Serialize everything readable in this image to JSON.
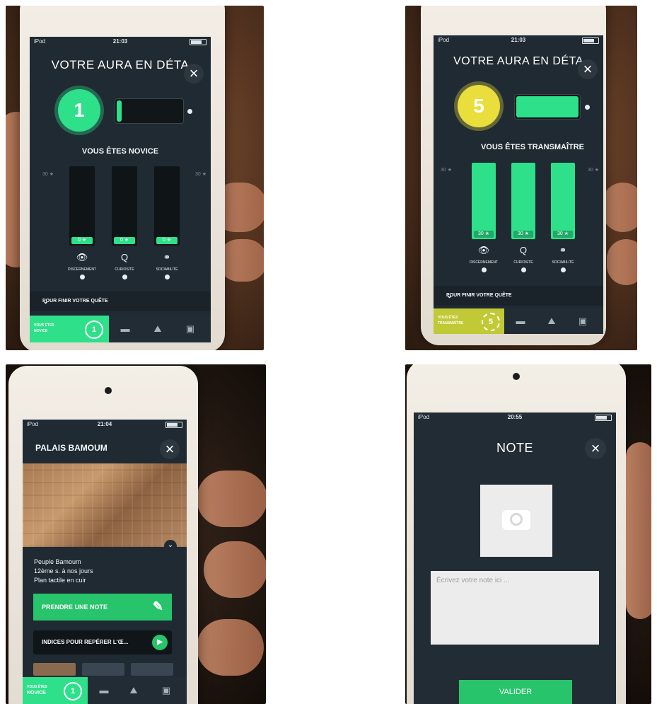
{
  "status": {
    "carrier": "iPod",
    "times": [
      "21:03",
      "21:03",
      "21:04",
      "20:55"
    ]
  },
  "screens": {
    "aura_novice": {
      "title": "VOTRE AURA EN DÉTA",
      "level": "1",
      "rank": "VOUS ÊTES NOVICE",
      "scale_left": "30 ★",
      "scale_right": "30 ★",
      "progress_fraction": 0.08,
      "traits": [
        {
          "name": "DISCERNEMENT",
          "icon": "eye-icon",
          "glyph": "👁",
          "score": "0 ★",
          "fill": 0.0
        },
        {
          "name": "CURIOSITÉ",
          "icon": "magnifier-icon",
          "glyph": "Q",
          "score": "0 ★",
          "fill": 0.0
        },
        {
          "name": "SOCIABILITÉ",
          "icon": "rings-icon",
          "glyph": "⚭",
          "score": "0 ★",
          "fill": 0.0
        }
      ],
      "quest": "POUR FINIR VOTRE QUÊTE",
      "tab_badge": {
        "line1": "VOUS ÊTES",
        "line2": "NOVICE",
        "level": "1"
      }
    },
    "aura_master": {
      "title": "VOTRE AURA EN DÉTA",
      "level": "5",
      "rank": "VOUS ÊTES TRANSMAÎTRE",
      "scale_left": "30 ★",
      "scale_right": "30 ★",
      "progress_fraction": 1.0,
      "traits": [
        {
          "name": "DISCERNEMENT",
          "icon": "crowned-eye-icon",
          "glyph": "👁",
          "score": "30 ★",
          "fill": 1.0
        },
        {
          "name": "CURIOSITÉ",
          "icon": "crowned-magnifier-icon",
          "glyph": "Q",
          "score": "30 ★",
          "fill": 1.0
        },
        {
          "name": "SOCIABILITÉ",
          "icon": "crowned-rings-icon",
          "glyph": "⚭",
          "score": "30 ★",
          "fill": 1.0
        }
      ],
      "quest": "POUR FINIR VOTRE QUÊTE",
      "tab_badge": {
        "line1": "VOUS ÊTES",
        "line2": "TRANSMAÎTRE",
        "level": "5"
      }
    },
    "palais": {
      "title": "PALAIS BAMOUM",
      "info": [
        "Peuple Bamoum",
        "12ème s. à nos jours",
        "Plan tactile en cuir"
      ],
      "note_button": "PRENDRE UNE NOTE",
      "hints_button": "INDICES POUR REPÉRER L'Œ...",
      "tab_badge": {
        "line1": "VOUS ÊTES",
        "line2": "NOVICE",
        "level": "1"
      }
    },
    "note": {
      "title": "NOTE",
      "placeholder": "Écrivez votre note ici ...",
      "submit": "VALIDER"
    }
  },
  "colors": {
    "accent_green": "#2ee08a",
    "button_green": "#27c46b",
    "gold": "#e9de3c",
    "screen_bg": "#1f2a33"
  }
}
